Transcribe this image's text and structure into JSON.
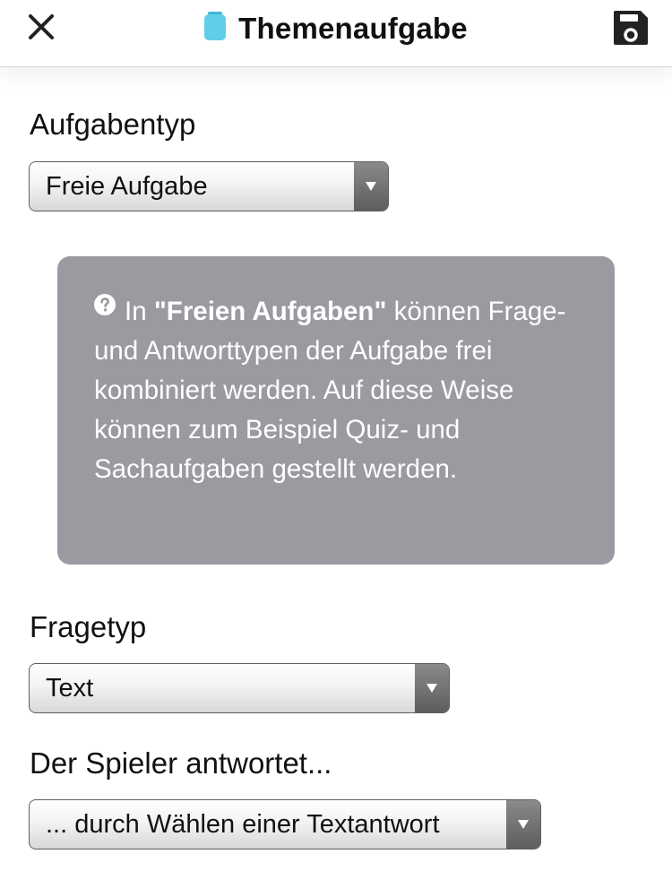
{
  "header": {
    "title": "Themenaufgabe",
    "title_icon": "clipboard-icon",
    "close_icon": "close-icon",
    "save_icon": "save-icon"
  },
  "task_type": {
    "label": "Aufgabentyp",
    "selected": "Freie Aufgabe"
  },
  "info": {
    "icon": "help-icon",
    "prefix": "In ",
    "highlight": "\"Freien Aufgaben\"",
    "text": " können Frage- und Antworttypen der Aufgabe frei kombiniert werden. Auf diese Weise können zum Beispiel Quiz- und Sachaufgaben gestellt werden."
  },
  "question_type": {
    "label": "Fragetyp",
    "selected": "Text"
  },
  "answer_type": {
    "label": "Der Spieler antwortet...",
    "selected": "... durch Wählen einer Textantwort"
  },
  "colors": {
    "accent_icon": "#5ecfe6",
    "info_background": "#9a9aa1",
    "text": "#111111"
  }
}
